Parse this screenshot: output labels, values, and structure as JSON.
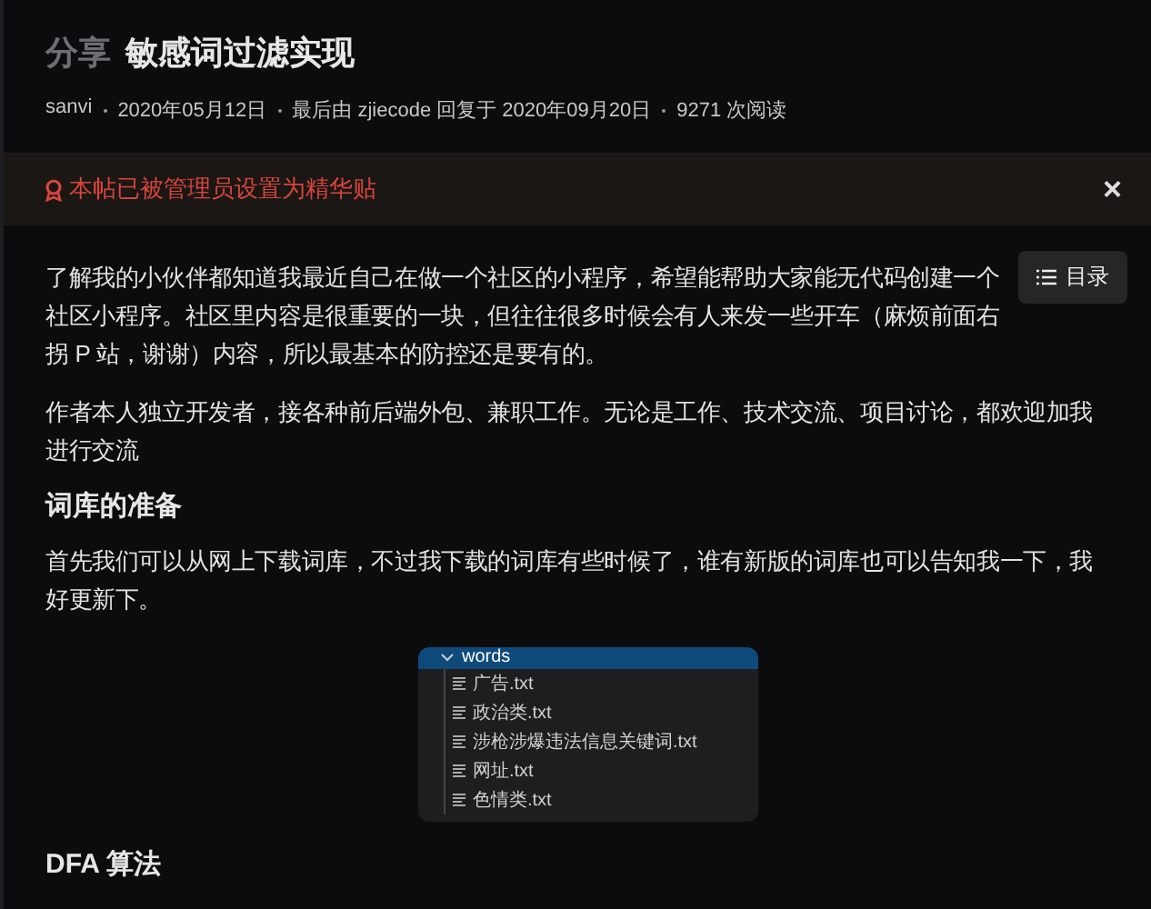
{
  "header": {
    "category": "分享",
    "title": "敏感词过滤实现",
    "meta": [
      "sanvi",
      "2020年05月12日",
      "最后由 zjiecode 回复于 2020年09月20日",
      "9271 次阅读"
    ]
  },
  "notice": {
    "text": "本帖已被管理员设置为精华贴",
    "close": "×"
  },
  "toc_button": "目录",
  "content": [
    {
      "kind": "paragraph",
      "text": "了解我的小伙伴都知道我最近自己在做一个社区的小程序，希望能帮助大家能无代码创建一个社区小程序。社区里内容是很重要的一块，但往往很多时候会有人来发一些开车（麻烦前面右拐 P 站，谢谢）内容，所以最基本的防控还是要有的。"
    },
    {
      "kind": "paragraph",
      "text": "作者本人独立开发者，接各种前后端外包、兼职工作。无论是工作、技术交流、项目讨论，都欢迎加我进行交流"
    },
    {
      "kind": "heading",
      "text": "词库的准备"
    },
    {
      "kind": "paragraph",
      "text": "首先我们可以从网上下载词库，不过我下载的词库有些时候了，谁有新版的词库也可以告知我一下，我好更新下。"
    },
    {
      "kind": "file_tree",
      "folder": {
        "name": "words",
        "expanded": true,
        "children": [
          {
            "name": "广告.txt"
          },
          {
            "name": "政治类.txt"
          },
          {
            "name": "涉枪涉爆违法信息关键词.txt"
          },
          {
            "name": "网址.txt"
          },
          {
            "name": "色情类.txt"
          }
        ]
      }
    },
    {
      "kind": "heading",
      "text": "DFA 算法"
    }
  ]
}
